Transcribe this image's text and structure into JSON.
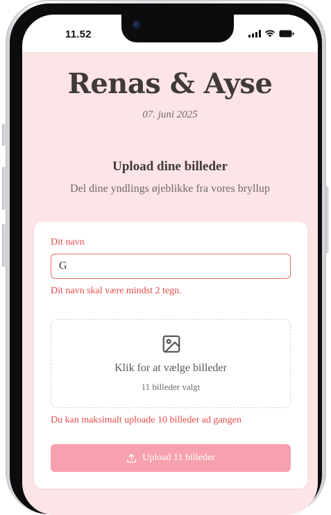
{
  "status_bar": {
    "time": "11.52"
  },
  "header": {
    "title": "Renas & Ayse",
    "date": "07. juni 2025"
  },
  "section": {
    "heading": "Upload dine billeder",
    "subtitle": "Del dine yndlings øjeblikke fra vores bryllup"
  },
  "form": {
    "name_label": "Dit navn",
    "name_value": "G",
    "name_error": "Dit navn skal være mindst 2 tegn.",
    "dropzone_title": "Klik for at vælge billeder",
    "dropzone_count": "11 billeder valgt",
    "limit_error": "Du kan maksimalt uploade 10 billeder ad gangen",
    "upload_label": "Upload 11 billeder"
  },
  "icons": {
    "dropzone": "image-icon",
    "upload": "upload-icon",
    "signal": "signal-icon",
    "wifi": "wifi-icon",
    "battery": "battery-icon"
  },
  "colors": {
    "page_background": "#fde4e6",
    "error": "#e34b4b",
    "button": "#f7a1ae",
    "text_dark": "#3f3a37"
  }
}
